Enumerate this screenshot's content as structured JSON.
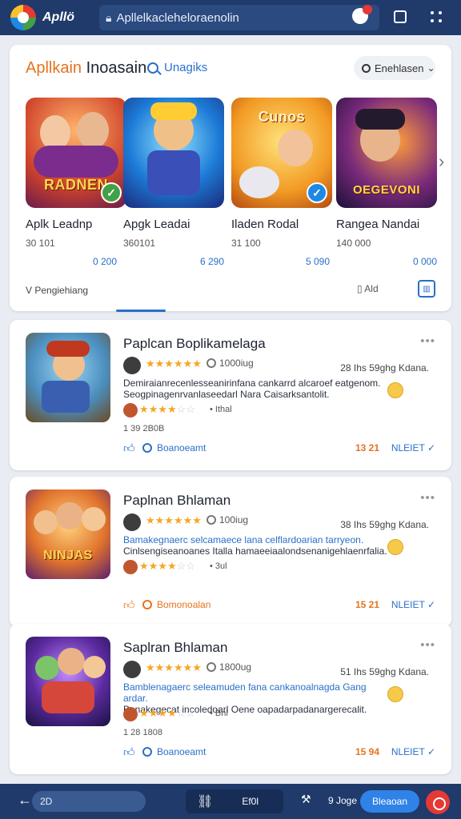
{
  "browser": {
    "app_title": "Apllö",
    "url": "Apllelkacleheloraenolin",
    "colors": {
      "bar": "#1f3a6b",
      "accent": "#2a6fc9",
      "orange": "#e6731e"
    }
  },
  "featured": {
    "title_part1": "Apllkain",
    "title_part2": " Inoasain",
    "link_label": "Unagiks",
    "sort_label": "Enehlasen",
    "games": [
      {
        "art_text": "RADNEN",
        "name": "Aplk Leadnp",
        "meta": "30 101",
        "price": "0 200",
        "badge": "green-check-icon"
      },
      {
        "art_text": "",
        "name": "Apgk Leadai",
        "meta": "360101",
        "price": "6 290",
        "badge": ""
      },
      {
        "art_text": "Cunos",
        "name": "Iladen Rodal",
        "meta": "31 100",
        "price": "5 090",
        "badge": "blue-check-icon"
      },
      {
        "art_text": "OEGEVONI",
        "name": "Rangea Nandai",
        "meta": "140 000",
        "price": "0 000",
        "badge": ""
      }
    ],
    "footer_text": "V Pengiehiang",
    "footer_mid": "Ald"
  },
  "reviews": [
    {
      "title": "Paplcan Boplikamelaga",
      "stars": "★★★★★★",
      "count": "1000iug",
      "date": "28 Ihs 59ghg Kdana.",
      "text_line1": "Demiraianrecenlesseanirinfana cankarrd alcaroef eatgenom.",
      "text_line2": "Seogpinagenrvanlaseedarl Nara Caisarksantolit.",
      "mini_stars_on": "★★★★",
      "mini_stars_off": "☆☆",
      "mini_label": "• Ithal",
      "votes": "1 39 2B0B",
      "reply_label": "Boanoeamt",
      "num": "13 21",
      "more_label": "NLEIET ✓"
    },
    {
      "title": "Paplnan Bhlaman",
      "stars": "★★★★★★",
      "count": "100iug",
      "date": "38 Ihs 59ghg Kdana.",
      "text_line1": "Bamakegnaerc selcamaece lana celflardoarian tarryeon.",
      "text_line2": "Cinlsengiseanoanes Italla hamaeeiaalondsenanigehlaenrfalia.",
      "mini_stars_on": "★★★★",
      "mini_stars_off": "☆☆",
      "mini_label": "• 3ul",
      "votes": "",
      "reply_label": "Bomonoalan",
      "num": "15 21",
      "more_label": "NLEIET ✓"
    },
    {
      "title": "Saplran Bhlaman",
      "stars": "★★★★★★",
      "count": "1800ug",
      "date": "51 Ihs 59ghg Kdana.",
      "text_line1": "Bamblenagaerc seleamuden fana cankanoalnagda Gang ardar.",
      "text_line2": "Banakegecat incoledoarl Oene oapadarpadanargerecalit.",
      "mini_stars_on": "★★★★",
      "mini_stars_off": "☆☆",
      "mini_label": "• Bhl",
      "votes": "1 28 1808",
      "reply_label": "Boanoeamt",
      "num": "15 94",
      "more_label": "NLEIET ✓"
    }
  ],
  "bottom": {
    "input_value": "2D",
    "center_label": "Ef0l",
    "count_label": "9 Joge",
    "primary_label": "Bleaoan"
  }
}
